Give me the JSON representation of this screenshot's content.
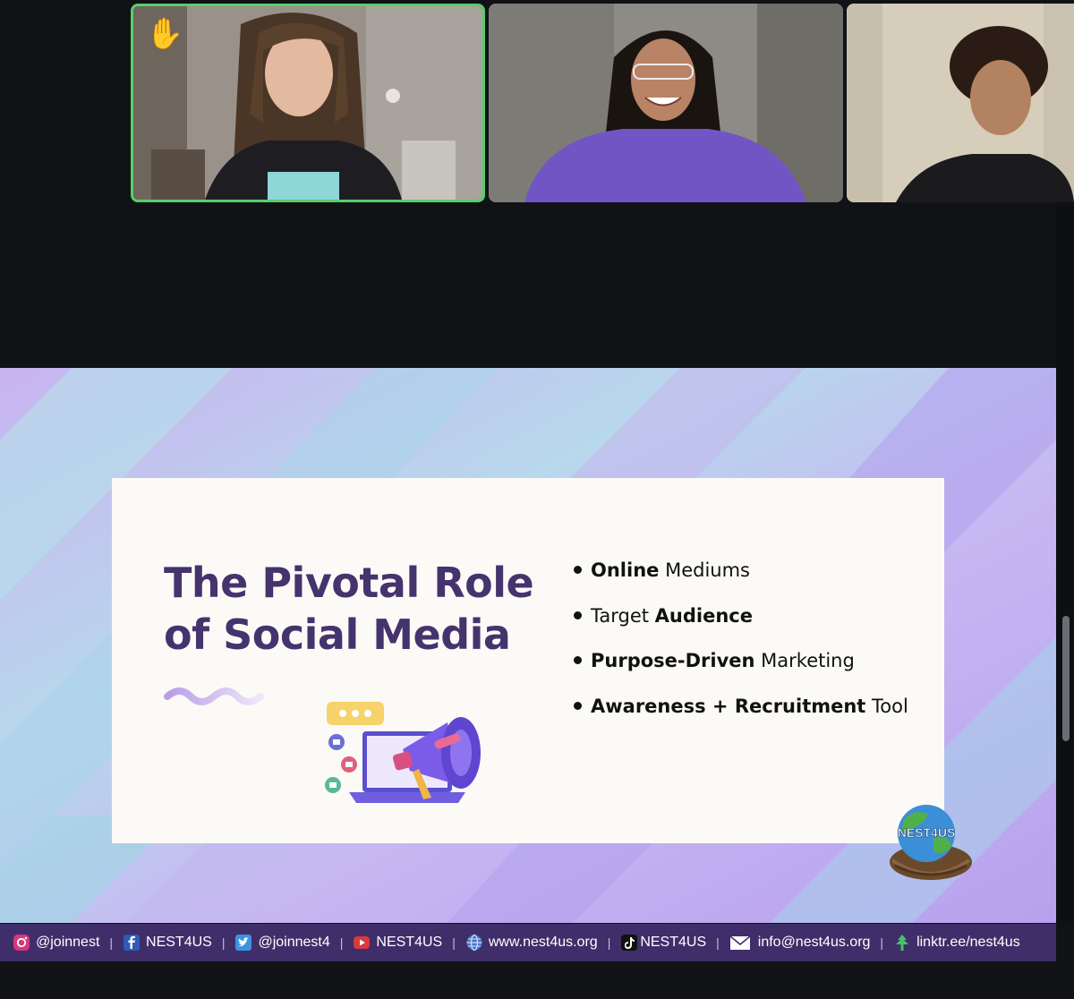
{
  "participants": [
    {
      "reaction_emoji": "✋",
      "is_active_speaker": true
    },
    {
      "reaction_emoji": "",
      "is_active_speaker": false
    },
    {
      "reaction_emoji": "",
      "is_active_speaker": false
    }
  ],
  "slide": {
    "title_line1": "The Pivotal Role",
    "title_line2": "of Social Media",
    "bullets": [
      {
        "bold": "Online",
        "rest": " Mediums"
      },
      {
        "pre": "Target ",
        "bold": "Audience"
      },
      {
        "bold": "Purpose-Driven",
        "rest": " Marketing"
      },
      {
        "bold": "Awareness + Recruitment",
        "rest": " Tool"
      }
    ],
    "logo_text": "NEST4US"
  },
  "footer": {
    "instagram": "@joinnest",
    "facebook": "NEST4US",
    "twitter": "@joinnest4",
    "youtube": "NEST4US",
    "website": "www.nest4us.org",
    "tiktok": "NEST4US",
    "email": "info@nest4us.org",
    "linktree": "linktr.ee/nest4us",
    "separator": "|"
  },
  "colors": {
    "active_speaker_border": "#56cf6a",
    "title_purple": "#45336e",
    "footer_bg": "#3f2e69",
    "megaphone_purple": "#7b5ce8"
  },
  "icons": [
    "raised-hand-icon",
    "instagram-icon",
    "facebook-icon",
    "twitter-icon",
    "youtube-icon",
    "globe-icon",
    "tiktok-icon",
    "mail-icon",
    "linktree-icon",
    "megaphone-icon",
    "laptop-icon",
    "like-icon",
    "chat-bubble-icon"
  ]
}
